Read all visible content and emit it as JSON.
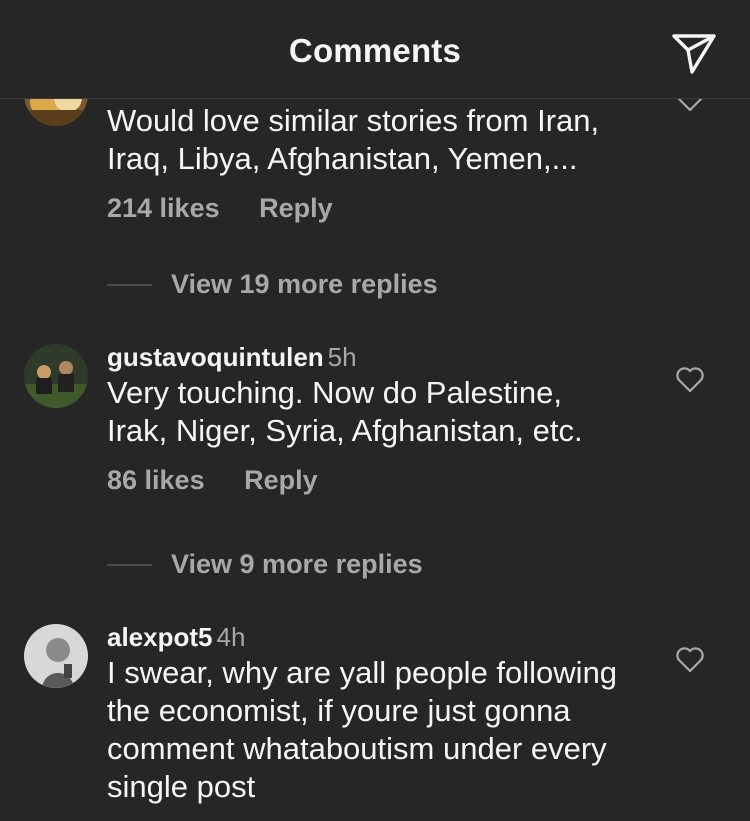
{
  "header": {
    "title": "Comments",
    "send_icon": "paper-plane-icon"
  },
  "comments": [
    {
      "username": "",
      "time": "",
      "text": "Would love similar stories from Iran,\nIraq, Libya, Afghanistan, Yemen,...",
      "likes": "214 likes",
      "reply": "Reply",
      "view_replies": "View 19 more replies"
    },
    {
      "username": "gustavoquintulen",
      "time": "5h",
      "text": "Very touching. Now do Palestine,\nIrak, Niger, Syria, Afghanistan, etc.",
      "likes": "86 likes",
      "reply": "Reply",
      "view_replies": "View 9 more replies"
    },
    {
      "username": "alexpot5",
      "time": "4h",
      "text": "I swear, why are yall people following\nthe economist, if youre just gonna\ncomment whataboutism under every\nsingle post"
    }
  ],
  "colors": {
    "background": "#262626",
    "text": "#f5f5f5",
    "secondary": "#a8a8a8"
  }
}
